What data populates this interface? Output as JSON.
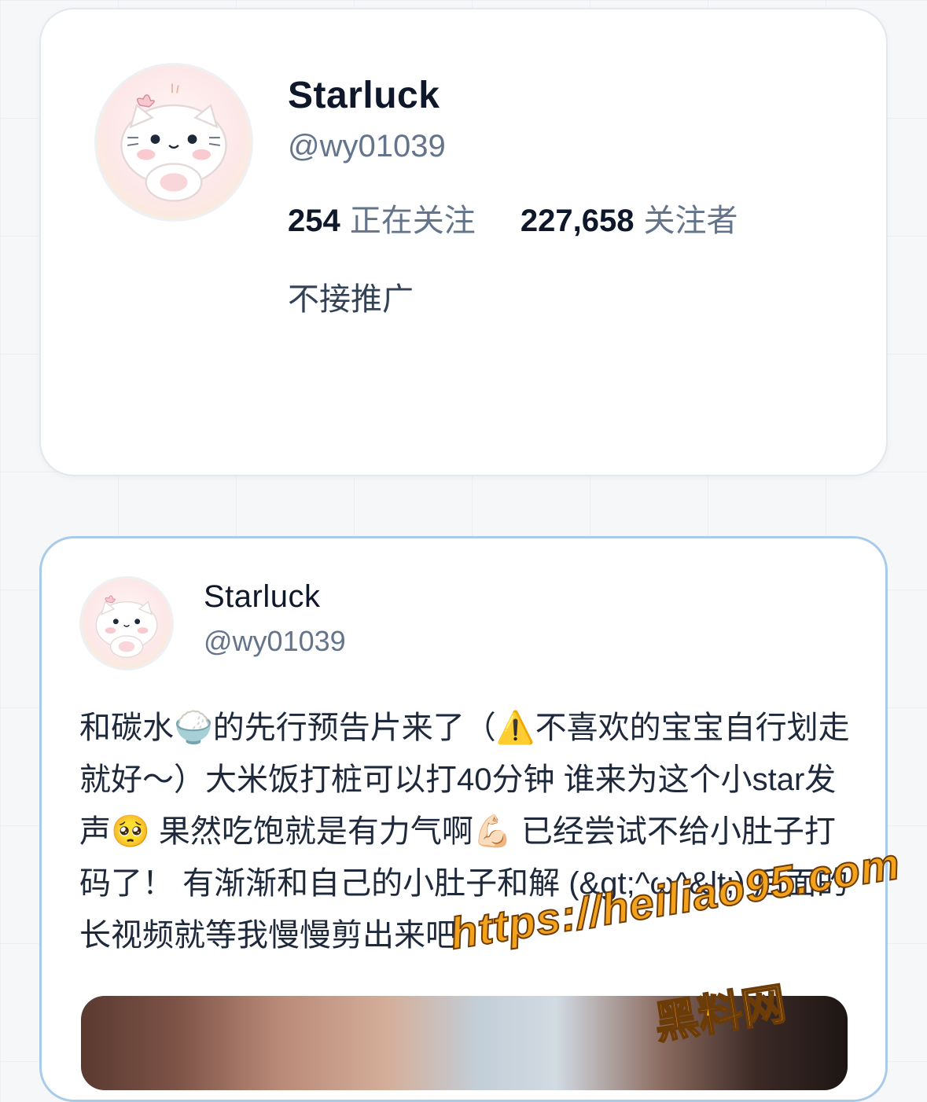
{
  "profile": {
    "display_name": "Starluck",
    "handle": "@wy01039",
    "following_count": "254",
    "following_label": "正在关注",
    "followers_count": "227,658",
    "followers_label": "关注者",
    "bio": "不接推广",
    "avatar_icon": "cat-avatar-icon"
  },
  "post": {
    "display_name": "Starluck",
    "handle": "@wy01039",
    "text": "和碳水🍚的先行预告片来了（⚠️不喜欢的宝宝自行划走就好～）大米饭打桩可以打40分钟 谁来为这个小star发声🥺 果然吃饱就是有力气啊💪🏻 已经尝试不给小肚子打码了！ 有渐渐和自己的小肚子和解 (&gt;^ω^&lt;) 后面的长视频就等我慢慢剪出来吧",
    "media": "video-thumbnail"
  },
  "watermark": {
    "url": "https://heiliao95.com",
    "name": "黑料网"
  },
  "colors": {
    "accent_border": "#a9cbe9",
    "text_primary": "#0f172a",
    "text_secondary": "#64748b"
  }
}
